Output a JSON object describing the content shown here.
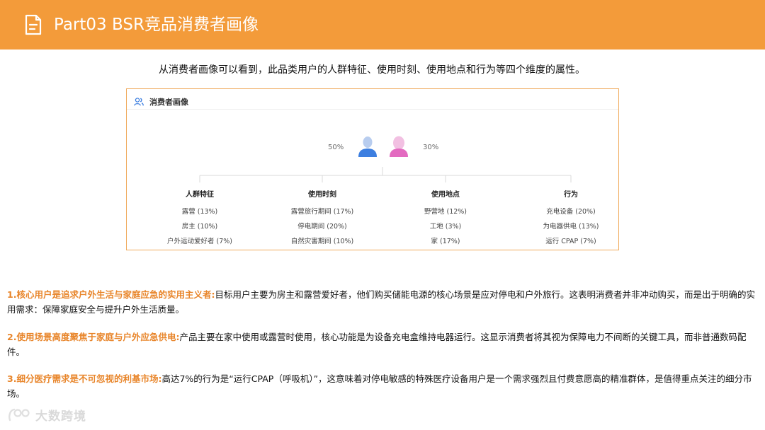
{
  "header": {
    "title": "Part03 BSR竞品消费者画像",
    "icon": "document-icon",
    "bg_color": "#f39b3a"
  },
  "intro": "从消费者画像可以看到，此品类用户的人群特征、使用时刻、使用地点和行为等四个维度的属性。",
  "card": {
    "title": "消费者画像",
    "icon": "users-icon",
    "male_pct": "50%",
    "female_pct": "30%",
    "columns": [
      {
        "heading": "人群特征",
        "items": [
          "露营 (13%)",
          "房主 (10%)",
          "户外运动爱好者 (7%)"
        ]
      },
      {
        "heading": "使用时刻",
        "items": [
          "露营旅行期间 (17%)",
          "停电期间 (20%)",
          "自然灾害期间 (10%)"
        ]
      },
      {
        "heading": "使用地点",
        "items": [
          "野营地 (12%)",
          "工地 (3%)",
          "家 (17%)"
        ]
      },
      {
        "heading": "行为",
        "items": [
          "充电设备 (20%)",
          "为电器供电 (13%)",
          "运行 CPAP (7%)"
        ]
      }
    ]
  },
  "findings": [
    {
      "title": "1.核心用户是追求户外生活与家庭应急的实用主义者:",
      "body": "目标用户主要为房主和露营爱好者，他们购买储能电源的核心场景是应对停电和户外旅行。这表明消费者并非冲动购买，而是出于明确的实用需求：保障家庭安全与提升户外生活质量。"
    },
    {
      "title": "2.使用场景高度聚焦于家庭与户外应急供电:",
      "body": "产品主要在家中使用或露营时使用，核心功能是为设备充电盒维持电器运行。这显示消费者将其视为保障电力不间断的关键工具，而非普通数码配件。"
    },
    {
      "title": "3.细分医疗需求是不可忽视的利基市场:",
      "body": "高达7%的行为是“运行CPAP（呼吸机）”，这意味着对停电敏感的特殊医疗设备用户是一个需求强烈且付费意愿高的精准群体，是值得重点关注的细分市场。"
    }
  ],
  "watermark": "大数跨境",
  "accent_color": "#e8852a",
  "male_color": "#3d7fe0",
  "female_color": "#e36ac0"
}
